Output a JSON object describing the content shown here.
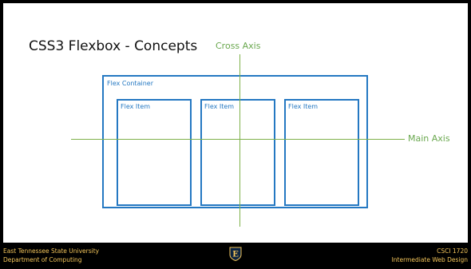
{
  "slide": {
    "title": "CSS3 Flexbox - Concepts"
  },
  "diagram": {
    "cross_axis_label": "Cross Axis",
    "main_axis_label": "Main Axis",
    "container_label": "Flex Container",
    "items": [
      {
        "label": "Flex Item"
      },
      {
        "label": "Flex Item"
      },
      {
        "label": "Flex Item"
      }
    ]
  },
  "footer": {
    "left_line1": "East Tennessee State University",
    "left_line2": "Department of Computing",
    "right_line1": "CSCI 1720",
    "right_line2": "Intermediate Web Design",
    "logo_letter": "E",
    "logo_icon": "etsu-shield-icon"
  },
  "colors": {
    "background": "#000000",
    "slide": "#ffffff",
    "axis": "#7fb24b",
    "axis_label": "#6aa84f",
    "box": "#2478c2",
    "footer_text": "#f2c45a"
  }
}
